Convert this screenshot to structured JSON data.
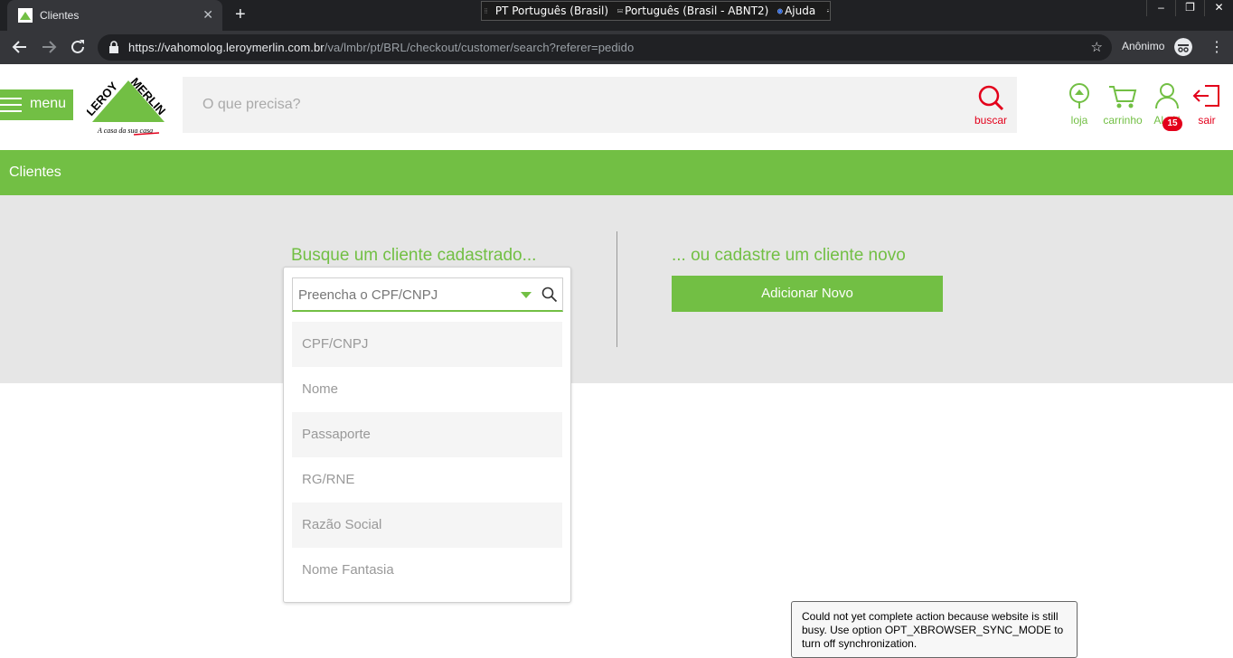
{
  "browser": {
    "tab_title": "Clientes",
    "tab_close": "✕",
    "new_tab": "+",
    "url_main": "https://vahomolog.leroymerlin.com.br",
    "url_path": "/va/lmbr/pt/BRL/checkout/customer/search?referer=pedido",
    "incognito_label": "Anônimo",
    "window_controls": [
      "–",
      "❐",
      "✕"
    ]
  },
  "langbar": {
    "lang": "PT Português (Brasil)",
    "keyboard": "Português (Brasil - ABNT2)",
    "help": "Ajuda"
  },
  "header": {
    "menu_label": "menu",
    "search_placeholder": "O que precisa?",
    "search_label": "buscar",
    "store_label": "loja",
    "cart_label": "carrinho",
    "user_label": "Al...N",
    "user_badge": "15",
    "logout_label": "sair",
    "logo_text": "LEROY MERLIN",
    "logo_tagline": "A casa da sua casa",
    "colors": {
      "brand_green": "#72bf44",
      "accent_red": "#e3001b"
    }
  },
  "band": {
    "title": "Clientes"
  },
  "search_section": {
    "heading_left": "Busque um cliente cadastrado...",
    "heading_right": "... ou cadastre um cliente novo",
    "add_button": "Adicionar Novo",
    "input_placeholder": "Preencha o CPF/CNPJ",
    "options": [
      "CPF/CNPJ",
      "Nome",
      "Passaporte",
      "RG/RNE",
      "Razão Social",
      "Nome Fantasia"
    ]
  },
  "toast": {
    "message": "Could not yet complete action because website is still busy. Use option OPT_XBROWSER_SYNC_MODE to turn off synchronization."
  }
}
